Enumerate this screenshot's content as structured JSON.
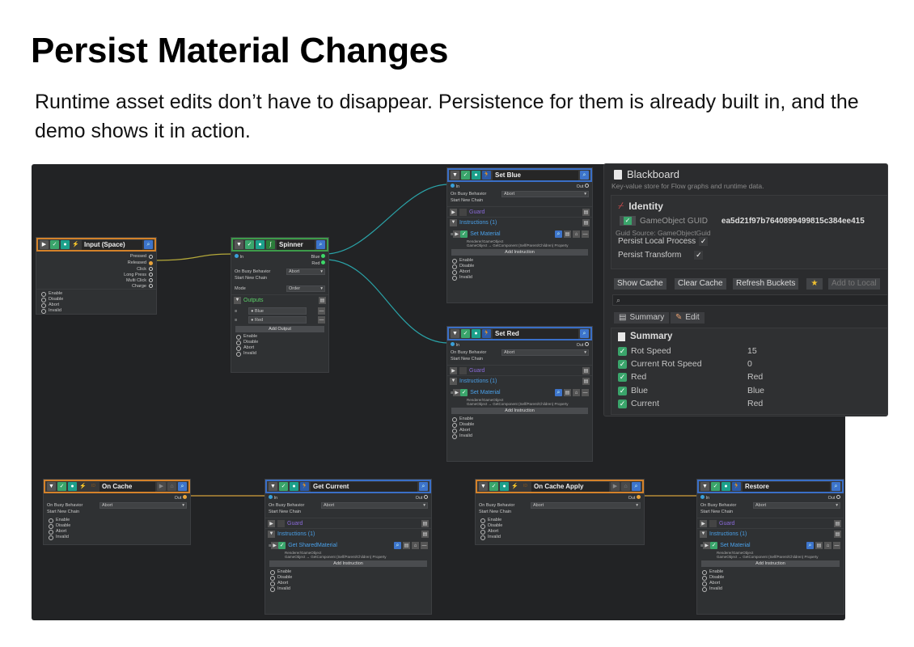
{
  "page": {
    "title": "Persist Material Changes",
    "subtitle": "Runtime asset edits don’t have to disappear. Persistence for them is already built in, and the demo shows it in action."
  },
  "common": {
    "in": "In",
    "out": "Out",
    "on_busy": "On Busy Behavior",
    "abort": "Abort",
    "start_chain": "Start New Chain",
    "guard": "Guard",
    "add_instruction": "Add Instruction",
    "enable": "Enable",
    "disable": "Disable",
    "abort_lbl": "Abort",
    "invalid": "Invalid",
    "renderer_line": "Renderer/GameObject",
    "getcomp_line": "GameObject → GetComponent (Self/Parent/Children) Property"
  },
  "input_node": {
    "title": "Input (Space)",
    "outputs": [
      "Pressed",
      "Released",
      "Click",
      "Long Press",
      "Multi Click",
      "Charge"
    ]
  },
  "spinner_node": {
    "title": "Spinner",
    "out_blue": "Blue",
    "out_red": "Red",
    "mode_label": "Mode",
    "mode_value": "Order",
    "outputs_header": "Outputs",
    "outputs": [
      "Blue",
      "Red"
    ],
    "add_output": "Add Output"
  },
  "set_blue": {
    "title": "Set Blue",
    "instructions": "Instructions (1)",
    "instruction": "Set Material"
  },
  "set_red": {
    "title": "Set Red",
    "instructions": "Instructions (1)",
    "instruction": "Set Material"
  },
  "on_cache": {
    "title": "On Cache"
  },
  "get_current": {
    "title": "Get Current",
    "instructions": "Instructions (1)",
    "instruction": "Get SharedMaterial"
  },
  "on_cache_apply": {
    "title": "On Cache Apply"
  },
  "restore": {
    "title": "Restore",
    "instructions": "Instructions (1)",
    "instruction": "Set Material"
  },
  "blackboard": {
    "title": "Blackboard",
    "desc": "Key-value store for Flow graphs and runtime data.",
    "identity": "Identity",
    "guid_label": "GameObject GUID",
    "guid_value": "ea5d21f97b7640899499815c384ee415",
    "guid_source": "Guid Source: GameObjectGuid",
    "persist_local": "Persist Local Process",
    "persist_transform": "Persist Transform",
    "buttons": [
      "Show Cache",
      "Clear Cache",
      "Refresh Buckets"
    ],
    "add_local": "Add to Local",
    "tab_summary": "Summary",
    "tab_edit": "Edit",
    "summary_title": "Summary",
    "rows": [
      {
        "key": "Rot Speed",
        "value": "15"
      },
      {
        "key": "Current Rot Speed",
        "value": "0"
      },
      {
        "key": "Red",
        "value": "Red"
      },
      {
        "key": "Blue",
        "value": "Blue"
      },
      {
        "key": "Current",
        "value": "Red"
      }
    ]
  },
  "colors": {
    "orange": "#d4822a",
    "green": "#3d9b4a",
    "blue": "#3a6fc7",
    "wire_teal": "#2aa3a8",
    "wire_yellow": "#b5a93a"
  }
}
